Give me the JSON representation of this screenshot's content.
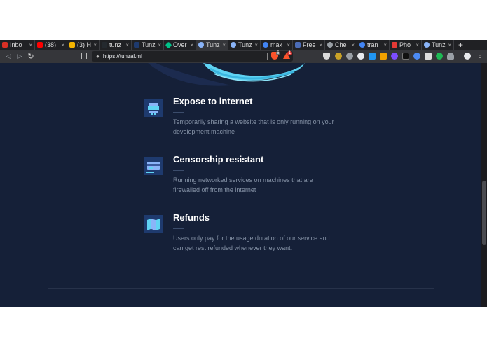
{
  "browser": {
    "tabs": [
      {
        "label": "Inbo",
        "color": "#d93025"
      },
      {
        "label": "(38)",
        "color": "#ff0000"
      },
      {
        "label": "(3) H",
        "color": "#f4b400"
      },
      {
        "label": "tunz",
        "color": "#24292e"
      },
      {
        "label": "Tunz",
        "color": "#1e3a6e"
      },
      {
        "label": "Over",
        "color": "#00c389"
      },
      {
        "label": "Tunz",
        "color": "#8ab4f8",
        "active": true
      },
      {
        "label": "Tunz",
        "color": "#8ab4f8"
      },
      {
        "label": "mak",
        "color": "#4285f4"
      },
      {
        "label": "Free",
        "color": "#4b6cb7"
      },
      {
        "label": "Che",
        "color": "#9aa0a6"
      },
      {
        "label": "tran",
        "color": "#4285f4"
      },
      {
        "label": "Pho",
        "color": "#e53935"
      },
      {
        "label": "Tunz",
        "color": "#8ab4f8"
      }
    ],
    "close_glyph": "×",
    "new_tab_glyph": "+",
    "url": "https://tunzal.ml",
    "nav": {
      "back": "◁",
      "forward": "▷",
      "reload": "↻",
      "bookmark": "🔖"
    },
    "menu_glyph": "⋮",
    "lock_glyph": "🔒",
    "brave_badge": "5",
    "rewards_badge": "1"
  },
  "features": [
    {
      "title": "Expose to internet",
      "description": "Temporarily sharing a website that is only running on your development machine",
      "icon": "server-icon"
    },
    {
      "title": "Censorship resistant",
      "description": "Running networked services on machines that are firewalled off from the internet",
      "icon": "card-icon"
    },
    {
      "title": "Refunds",
      "description": "Users only pay for the usage duration of our service and can get rest refunded whenever they want.",
      "icon": "map-icon"
    }
  ],
  "colors": {
    "page_bg": "#152038",
    "accent": "#5fd3f3",
    "icon_bg": "#1e3a6e",
    "title": "#ffffff",
    "description": "#8592a6"
  }
}
